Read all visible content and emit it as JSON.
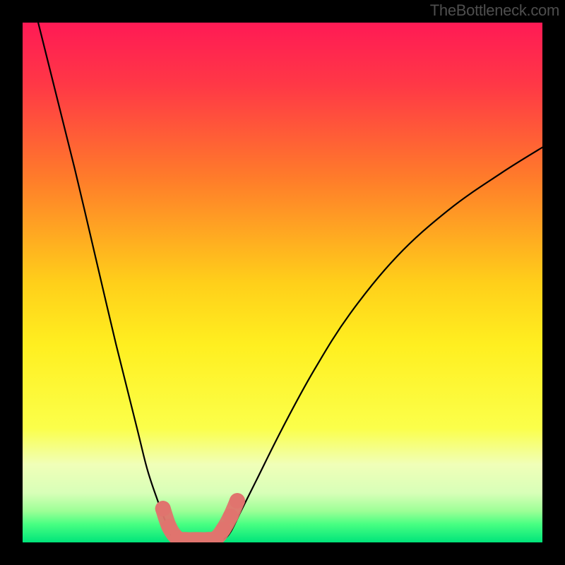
{
  "watermark": "TheBottleneck.com",
  "chart_data": {
    "type": "line",
    "title": "",
    "xlabel": "",
    "ylabel": "",
    "xlim": [
      0,
      100
    ],
    "ylim": [
      0,
      100
    ],
    "gradient_stops": [
      {
        "offset": 0.0,
        "color": "#ff1a55"
      },
      {
        "offset": 0.12,
        "color": "#ff3846"
      },
      {
        "offset": 0.3,
        "color": "#ff7c2a"
      },
      {
        "offset": 0.5,
        "color": "#ffcf1a"
      },
      {
        "offset": 0.62,
        "color": "#ffef20"
      },
      {
        "offset": 0.78,
        "color": "#fbff4a"
      },
      {
        "offset": 0.85,
        "color": "#f0ffb8"
      },
      {
        "offset": 0.905,
        "color": "#d8ffb8"
      },
      {
        "offset": 0.94,
        "color": "#9cff96"
      },
      {
        "offset": 0.965,
        "color": "#48ff82"
      },
      {
        "offset": 1.0,
        "color": "#00e47a"
      }
    ],
    "series": [
      {
        "name": "left-descent",
        "x": [
          3,
          6,
          10,
          14,
          18,
          22,
          24,
          26,
          27.5,
          28.5,
          29.2
        ],
        "y": [
          100,
          88,
          72,
          55,
          38,
          22,
          14,
          8,
          4,
          1.5,
          0.5
        ]
      },
      {
        "name": "right-ascent",
        "x": [
          38.5,
          40,
          42,
          45,
          50,
          56,
          63,
          72,
          82,
          92,
          100
        ],
        "y": [
          0.5,
          2,
          6,
          12,
          22,
          33,
          44,
          55,
          64,
          71,
          76
        ]
      },
      {
        "name": "valley-floor",
        "x": [
          29.2,
          31,
          33,
          35,
          37,
          38.5
        ],
        "y": [
          0.5,
          0.3,
          0.3,
          0.3,
          0.3,
          0.5
        ]
      }
    ],
    "highlight_points": {
      "color": "#e0746e",
      "radius": 11,
      "points": [
        {
          "x": 27.0,
          "y": 6.5
        },
        {
          "x": 28.2,
          "y": 3.0
        },
        {
          "x": 29.8,
          "y": 0.8
        },
        {
          "x": 31.5,
          "y": 0.5
        },
        {
          "x": 33.5,
          "y": 0.5
        },
        {
          "x": 35.5,
          "y": 0.5
        },
        {
          "x": 37.2,
          "y": 0.8
        },
        {
          "x": 38.6,
          "y": 2.5
        },
        {
          "x": 40.0,
          "y": 5.0
        },
        {
          "x": 41.3,
          "y": 8.0
        }
      ]
    }
  }
}
